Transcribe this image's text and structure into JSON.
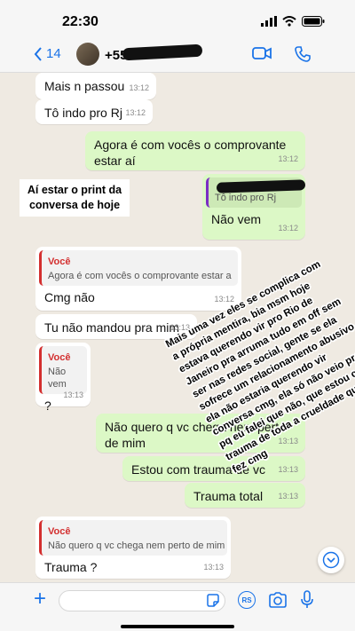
{
  "status": {
    "time": "22:30"
  },
  "header": {
    "back_count": "14",
    "contact_prefix": "+55"
  },
  "messages": [
    {
      "text": "Mais n passou",
      "time": "13:12"
    },
    {
      "text": "Tô indo pro Rj",
      "time": "13:12"
    },
    {
      "text": "Agora é com vocês o comprovante estar aí",
      "time": "13:12"
    },
    {
      "quote_text": "Tô indo pro Rj",
      "text": "Não vem",
      "time": "13:12"
    },
    {
      "quote_author": "Você",
      "quote_text": "Agora é com vocês o comprovante estar aí",
      "text": "Cmg não",
      "time": "13:12"
    },
    {
      "text": "Tu não mandou pra mim",
      "time": "13:13"
    },
    {
      "quote_author": "Você",
      "quote_text": "Não vem",
      "text": "?",
      "time": "13:13"
    },
    {
      "text": "Não quero q vc chega nem perto de mim",
      "time": "13:13"
    },
    {
      "text": "Estou com trauma de vc",
      "time": "13:13"
    },
    {
      "text": "Trauma total",
      "time": "13:13"
    },
    {
      "quote_author": "Você",
      "quote_text": "Não quero q vc chega nem perto de mim",
      "text": "Trauma ?",
      "time": "13:13"
    }
  ],
  "overlay": {
    "sticker": "Aí estar o print da conversa de hoje",
    "caption": "Mais uma vez eles se complica com a própria mentira, bia msm hoje estava querendo vir pro Rio de Janeiro pra arruma tudo em off sem ser nas redes social, gente se ela sofrece um relacionamento abusivo ela não estaria querendo vir conversa cmg, ela só não veio pro rj pq eu falei que não, que estou com trauma de toda a crueldade que ela fez cmg"
  },
  "input": {
    "placeholder": "",
    "value": ""
  },
  "icons": [
    "back-chevron-icon",
    "video-call-icon",
    "phone-icon",
    "plus-icon",
    "sticker-icon",
    "rs-icon",
    "camera-icon",
    "microphone-icon",
    "chevron-down-icon"
  ],
  "colors": {
    "accent": "#1a73e8",
    "outgoing": "#dcf8c6",
    "incoming": "#ffffff",
    "quote_author": "#d32f2f",
    "chat_bg": "#efeae2"
  }
}
